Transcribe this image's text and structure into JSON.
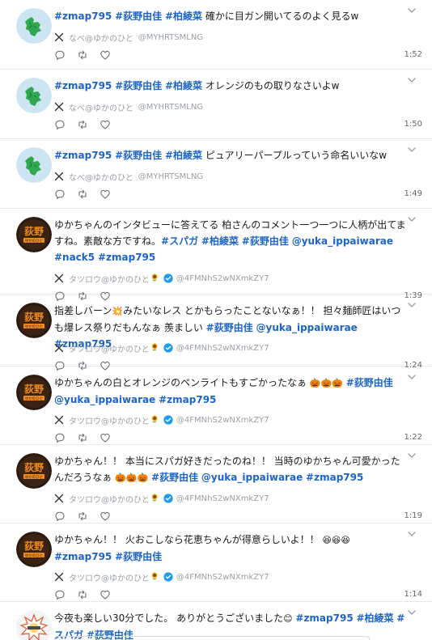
{
  "colors": {
    "tag": "#1d64c8",
    "meta": "#9aa0a6",
    "verified": "#1d9bf0",
    "divider": "#e6e9ec"
  },
  "icons": {
    "caret": "chevron-down-icon",
    "source": "x-logo-icon",
    "verified": "verified-badge-icon",
    "reply": "reply-icon",
    "repost": "repost-icon",
    "like": "heart-icon"
  },
  "tweets": [
    {
      "avatar": "green-map-avatar",
      "text": [
        {
          "t": "#zmap795",
          "tag": true
        },
        {
          "t": " ",
          "tag": false
        },
        {
          "t": "#荻野由佳",
          "tag": true
        },
        {
          "t": " ",
          "tag": false
        },
        {
          "t": "#柏綾菜",
          "tag": true
        },
        {
          "t": " 確かに目ガン開いてるのよく見るw",
          "tag": false
        }
      ],
      "source_name": "なべ@ゆかのひと",
      "source_handle": "@MYHRTSMLNG",
      "verified": false,
      "time": "1:52"
    },
    {
      "avatar": "green-map-avatar",
      "text": [
        {
          "t": "#zmap795",
          "tag": true
        },
        {
          "t": " ",
          "tag": false
        },
        {
          "t": "#荻野由佳",
          "tag": true
        },
        {
          "t": " ",
          "tag": false
        },
        {
          "t": "#柏綾菜",
          "tag": true
        },
        {
          "t": " オレンジのもの取りなさいよw",
          "tag": false
        }
      ],
      "source_name": "なべ@ゆかのひと",
      "source_handle": "@MYHRTSMLNG",
      "verified": false,
      "time": "1:50"
    },
    {
      "avatar": "green-map-avatar",
      "text": [
        {
          "t": "#zmap795",
          "tag": true
        },
        {
          "t": " ",
          "tag": false
        },
        {
          "t": "#荻野由佳",
          "tag": true
        },
        {
          "t": " ",
          "tag": false
        },
        {
          "t": "#柏綾菜",
          "tag": true
        },
        {
          "t": " ピュアリーパープルっていう命名いいなw",
          "tag": false
        }
      ],
      "source_name": "なべ@ゆかのひと",
      "source_handle": "@MYHRTSMLNG",
      "verified": false,
      "time": "1:49"
    },
    {
      "avatar": "ogino-badge-avatar",
      "text": [
        {
          "t": "ゆかちゃんのインタビューに答えてる 柏さんのコメント一つ一つに人柄が出てますね。素敵な方ですね。",
          "tag": false
        },
        {
          "t": "#スパガ",
          "tag": true
        },
        {
          "t": " ",
          "tag": false
        },
        {
          "t": "#柏綾菜",
          "tag": true
        },
        {
          "t": " ",
          "tag": false
        },
        {
          "t": "#荻野由佳",
          "tag": true
        },
        {
          "t": " ",
          "tag": false
        },
        {
          "t": "@yuka_ippaiwarae",
          "tag": true
        },
        {
          "t": " ",
          "tag": false
        },
        {
          "t": "#nack5",
          "tag": true
        },
        {
          "t": " ",
          "tag": false
        },
        {
          "t": "#zmap795",
          "tag": true
        }
      ],
      "source_name": "タツロウ@ゆかのひと",
      "source_emoji": "🌻",
      "source_handle": "@4FMNhS2wNXmkZY7",
      "verified": true,
      "time": "1:39"
    },
    {
      "avatar": "ogino-badge-avatar",
      "text": [
        {
          "t": "指差しバーン",
          "tag": false
        },
        {
          "t": "💥",
          "tag": false,
          "emoji": true
        },
        {
          "t": "みたいなレス とかもらったことないなぁ！！ 担々麺師匠はいつも爆レス祭りだもんなぁ 羨ましい ",
          "tag": false
        },
        {
          "t": "#荻野由佳",
          "tag": true
        },
        {
          "t": " ",
          "tag": false
        },
        {
          "t": "@yuka_ippaiwarae",
          "tag": true
        },
        {
          "t": " ",
          "tag": false
        },
        {
          "t": "#zmap795",
          "tag": true
        }
      ],
      "source_name": "タツロウ@ゆかのひと",
      "source_emoji": "🌻",
      "source_handle": "@4FMNhS2wNXmkZY7",
      "verified": true,
      "time": "1:24"
    },
    {
      "avatar": "ogino-badge-avatar",
      "text": [
        {
          "t": "ゆかちゃんの白とオレンジのペンライトもすごかったなぁ ",
          "tag": false
        },
        {
          "t": "🎃🎃🎃",
          "tag": false,
          "emoji": true
        },
        {
          "t": " ",
          "tag": false
        },
        {
          "t": "#荻野由佳",
          "tag": true
        },
        {
          "t": " ",
          "tag": false
        },
        {
          "t": "@yuka_ippaiwarae",
          "tag": true
        },
        {
          "t": " ",
          "tag": false
        },
        {
          "t": "#zmap795",
          "tag": true
        }
      ],
      "source_name": "タツロウ@ゆかのひと",
      "source_emoji": "🌻",
      "source_handle": "@4FMNhS2wNXmkZY7",
      "verified": true,
      "time": "1:22"
    },
    {
      "avatar": "ogino-badge-avatar",
      "text": [
        {
          "t": "ゆかちゃん！！ 本当にスパガ好きだったのね！！ 当時のゆかちゃん可愛かったんだろうなぁ ",
          "tag": false
        },
        {
          "t": "🎃🎃🎃",
          "tag": false,
          "emoji": true
        },
        {
          "t": " ",
          "tag": false
        },
        {
          "t": "#荻野由佳",
          "tag": true
        },
        {
          "t": " ",
          "tag": false
        },
        {
          "t": "@yuka_ippaiwarae",
          "tag": true
        },
        {
          "t": " ",
          "tag": false
        },
        {
          "t": "#zmap795",
          "tag": true
        }
      ],
      "source_name": "タツロウ@ゆかのひと",
      "source_emoji": "🌻",
      "source_handle": "@4FMNhS2wNXmkZY7",
      "verified": true,
      "time": "1:19"
    },
    {
      "avatar": "ogino-badge-avatar",
      "text": [
        {
          "t": "ゆかちゃん！！ 火おこしなら花恵ちゃんが得意らしいよ！！ ",
          "tag": false
        },
        {
          "t": "😆😆😆",
          "tag": false,
          "emoji": true
        },
        {
          "t": " ",
          "tag": false
        },
        {
          "t": "#zmap795",
          "tag": true
        },
        {
          "t": " ",
          "tag": false
        },
        {
          "t": "#荻野由佳",
          "tag": true
        }
      ],
      "source_name": "タツロウ@ゆかのひと",
      "source_emoji": "🌻",
      "source_handle": "@4FMNhS2wNXmkZY7",
      "verified": true,
      "time": "1:14"
    },
    {
      "avatar": "starburst-logo-avatar",
      "text": [
        {
          "t": "今夜も楽しい30分でした。 ありがとうございました",
          "tag": false
        },
        {
          "t": "😊",
          "tag": false,
          "emoji": true
        },
        {
          "t": " ",
          "tag": false
        },
        {
          "t": "#zmap795",
          "tag": true
        },
        {
          "t": " ",
          "tag": false
        },
        {
          "t": "#柏綾菜",
          "tag": true
        },
        {
          "t": " ",
          "tag": false
        },
        {
          "t": "#スパガ",
          "tag": true
        },
        {
          "t": " ",
          "tag": false
        },
        {
          "t": "#荻野由佳",
          "tag": true
        }
      ],
      "source_name": "",
      "source_handle": "",
      "verified": false,
      "time": ""
    }
  ]
}
